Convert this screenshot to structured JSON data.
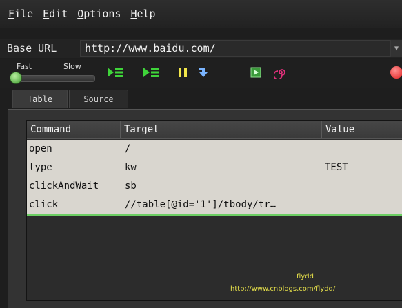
{
  "menu": {
    "items": [
      {
        "mnemonic": "F",
        "rest": "ile"
      },
      {
        "mnemonic": "E",
        "rest": "dit"
      },
      {
        "mnemonic": "O",
        "rest": "ptions"
      },
      {
        "mnemonic": "H",
        "rest": "elp"
      }
    ]
  },
  "url": {
    "label": "Base URL",
    "value": "http://www.baidu.com/"
  },
  "speed": {
    "fast_label": "Fast",
    "slow_label": "Slow"
  },
  "tabs": {
    "table": "Table",
    "source": "Source"
  },
  "table": {
    "headers": [
      "Command",
      "Target",
      "Value"
    ],
    "rows": [
      {
        "command": "open",
        "target": "/",
        "value": ""
      },
      {
        "command": "type",
        "target": "kw",
        "value": "TEST"
      },
      {
        "command": "clickAndWait",
        "target": "sb",
        "value": ""
      },
      {
        "command": "click",
        "target": "//table[@id='1']/tbody/tr…",
        "value": ""
      }
    ]
  },
  "watermark": {
    "line1": "flydd",
    "line2": "http://www.cnblogs.com/flydd/"
  },
  "colors": {
    "play_green": "#3fd43a",
    "pause_yellow": "#f2e64a",
    "record_red": "#e02020",
    "selection_line": "#6ccf63"
  }
}
